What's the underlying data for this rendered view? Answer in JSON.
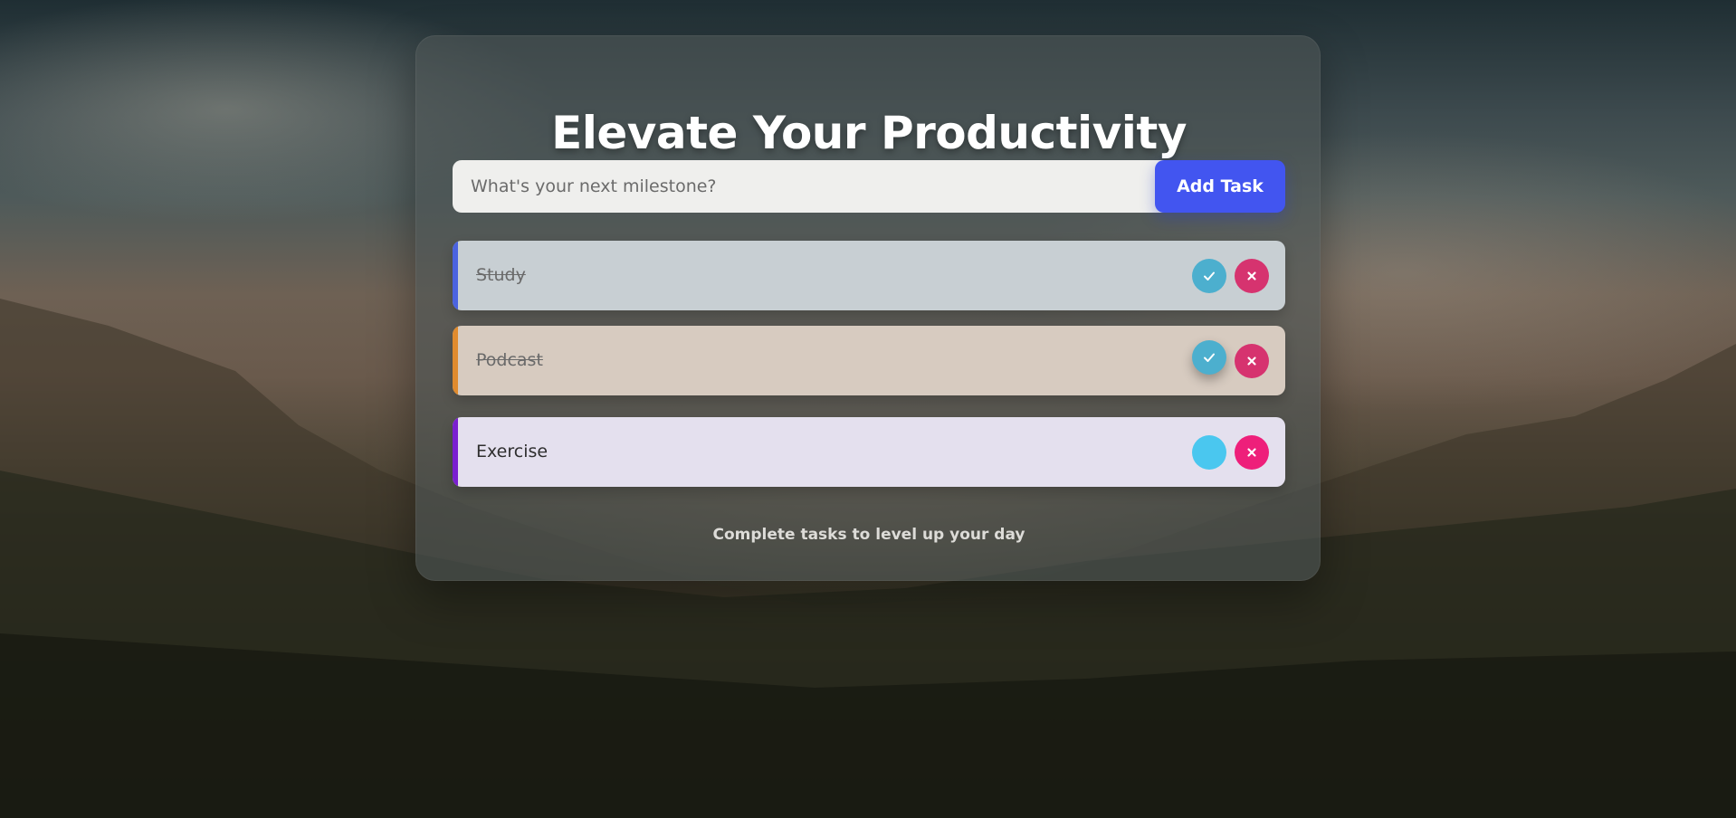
{
  "app": {
    "title": "Elevate Your Productivity",
    "input": {
      "placeholder": "What's your next milestone?",
      "value": ""
    },
    "add_button_label": "Add Task",
    "tasks": [
      {
        "label": "Study",
        "completed": true,
        "accent_color": "#4b63e0",
        "complete_icon": "check-icon",
        "delete_icon": "close-icon"
      },
      {
        "label": "Podcast",
        "completed": true,
        "accent_color": "#e08b2e",
        "complete_icon": "check-icon",
        "delete_icon": "close-icon"
      },
      {
        "label": "Exercise",
        "completed": false,
        "accent_color": "#7a1fd0",
        "complete_icon": "check-icon",
        "delete_icon": "close-icon"
      }
    ],
    "footer": "Complete tasks to level up your day"
  },
  "colors": {
    "add_button": "#4255f0",
    "complete_button": "#4cafce",
    "delete_button": "#d6336f"
  }
}
